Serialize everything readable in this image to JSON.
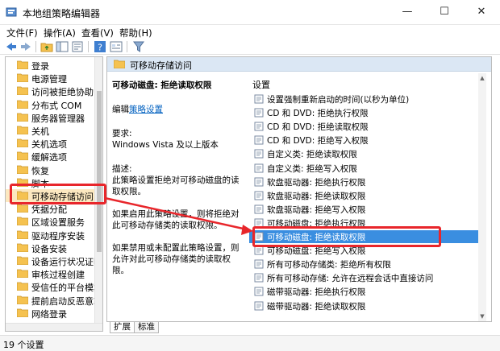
{
  "window": {
    "title": "本地组策略编辑器",
    "minimize": "—",
    "maximize": "☐",
    "close": "✕"
  },
  "menu": [
    {
      "label": "文件(F)"
    },
    {
      "label": "操作(A)"
    },
    {
      "label": "查看(V)"
    },
    {
      "label": "帮助(H)"
    }
  ],
  "tree": {
    "items": [
      {
        "label": "登录"
      },
      {
        "label": "电源管理"
      },
      {
        "label": "访问被拒绝协助"
      },
      {
        "label": "分布式 COM"
      },
      {
        "label": "服务器管理器"
      },
      {
        "label": "关机"
      },
      {
        "label": "关机选项"
      },
      {
        "label": "缓解选项"
      },
      {
        "label": "恢复"
      },
      {
        "label": "脚本"
      },
      {
        "label": "可移动存储访问"
      },
      {
        "label": "凭据分配"
      },
      {
        "label": "区域设置服务"
      },
      {
        "label": "驱动程序安装"
      },
      {
        "label": "设备安装"
      },
      {
        "label": "设备运行状况证明"
      },
      {
        "label": "审核过程创建"
      },
      {
        "label": "受信任的平台模块"
      },
      {
        "label": "提前启动反恶意软"
      },
      {
        "label": "网络登录"
      }
    ],
    "selected_index": 10
  },
  "right": {
    "header": "可移动存储访问",
    "desc": {
      "title": "可移动磁盘: 拒绝读取权限",
      "edit_prefix": "编辑",
      "edit_link": "策略设置",
      "req_label": "要求:",
      "req_value": "Windows Vista 及以上版本",
      "desc_label": "描述:",
      "desc_text": "此策略设置拒绝对可移动磁盘的读取权限。",
      "enabled_text": "如果启用此策略设置，则将拒绝对此可移动存储类的读取权限。",
      "disabled_text": "如果禁用或未配置此策略设置，则允许对此可移动存储类的读取权限。"
    },
    "settings_header": "设置",
    "settings": [
      {
        "label": "设置强制重新启动的时间(以秒为单位)"
      },
      {
        "label": "CD 和 DVD: 拒绝执行权限"
      },
      {
        "label": "CD 和 DVD: 拒绝读取权限"
      },
      {
        "label": "CD 和 DVD: 拒绝写入权限"
      },
      {
        "label": "自定义类: 拒绝读取权限"
      },
      {
        "label": "自定义类: 拒绝写入权限"
      },
      {
        "label": "软盘驱动器: 拒绝执行权限"
      },
      {
        "label": "软盘驱动器: 拒绝读取权限"
      },
      {
        "label": "软盘驱动器: 拒绝写入权限"
      },
      {
        "label": "可移动磁盘: 拒绝执行权限"
      },
      {
        "label": "可移动磁盘: 拒绝读取权限"
      },
      {
        "label": "可移动磁盘: 拒绝写入权限"
      },
      {
        "label": "所有可移动存储类: 拒绝所有权限"
      },
      {
        "label": "所有可移动存储: 允许在远程会话中直接访问"
      },
      {
        "label": "磁带驱动器: 拒绝执行权限"
      },
      {
        "label": "磁带驱动器: 拒绝读取权限"
      }
    ],
    "selected_setting_index": 10
  },
  "tabs": [
    {
      "label": "扩展"
    },
    {
      "label": "标准"
    }
  ],
  "status": {
    "text": "19 个设置"
  },
  "colors": {
    "highlight": "#e8262b",
    "selection": "#3a8ee0",
    "header": "#dbe7f4",
    "folder": "#f5c250"
  }
}
